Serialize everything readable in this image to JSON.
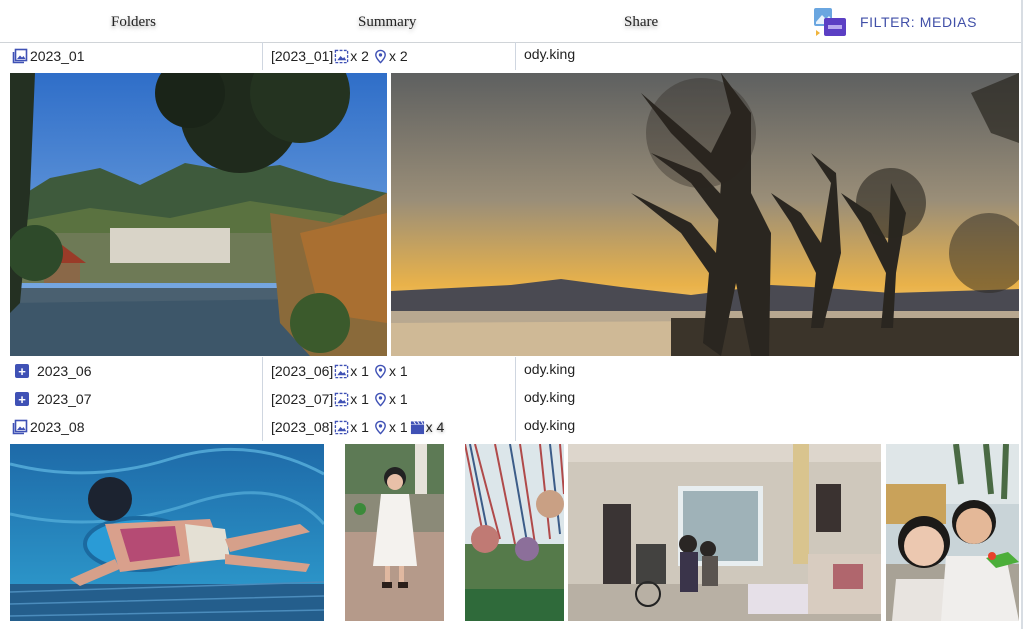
{
  "header": {
    "folders_label": "Folders",
    "summary_label": "Summary",
    "share_label": "Share",
    "filter_label": "FILTER: MEDIAS",
    "filter_icon": "pdf-file-icon"
  },
  "rows": [
    {
      "name": "2023_01",
      "icon": "gallery-icon",
      "summary_tag": "[2023_01]",
      "photos": "x 2",
      "places": "x 2",
      "share": "ody.king"
    },
    {
      "name": "2023_06",
      "icon": "expand-plus-icon",
      "summary_tag": "[2023_06]",
      "photos": "x 1",
      "places": "x 1",
      "share": "ody.king"
    },
    {
      "name": "2023_07",
      "icon": "expand-plus-icon",
      "summary_tag": "[2023_07]",
      "photos": "x 1",
      "places": "x 1",
      "share": "ody.king"
    },
    {
      "name": "2023_08",
      "icon": "gallery-icon",
      "summary_tag": "[2023_08]",
      "photos": "x 1",
      "places": "x 1",
      "videos": "x 4",
      "share": "ody.king"
    }
  ],
  "colors": {
    "accent": "#3f51b5",
    "filter_text": "#4150a8",
    "divider": "#cfd6e0"
  }
}
